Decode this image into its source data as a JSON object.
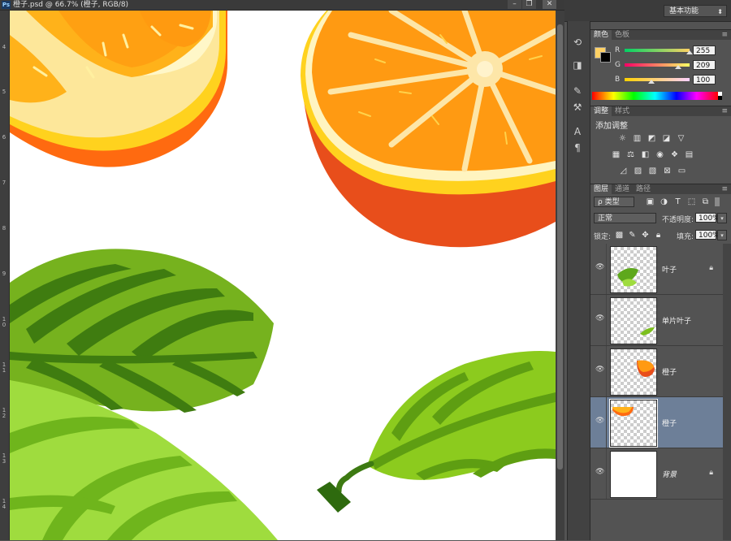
{
  "document": {
    "title": "橙子.psd @ 66.7% (橙子, RGB/8)",
    "app_badge": "Ps",
    "window_controls": [
      "–",
      "❐",
      "✕"
    ],
    "ruler_labels": [
      "4",
      "5",
      "6",
      "7",
      "8",
      "9",
      "1\n0",
      "1\n1",
      "1\n2",
      "1\n3",
      "1\n4"
    ]
  },
  "workspace": {
    "label": "基本功能"
  },
  "color_panel": {
    "tabs": [
      "颜色",
      "色板"
    ],
    "fg_color": "#ffd164",
    "bg_color": "#000000",
    "r_label": "R",
    "g_label": "G",
    "b_label": "B",
    "r_value": "255",
    "g_value": "209",
    "b_value": "100"
  },
  "adjustments_panel": {
    "tabs": [
      "调整",
      "样式"
    ],
    "heading": "添加调整"
  },
  "layers_panel": {
    "tabs": [
      "图层",
      "通道",
      "路径"
    ],
    "filter_label": "ρ 类型",
    "blend_mode": "正常",
    "opacity_label": "不透明度:",
    "opacity_value": "100%",
    "lock_label": "锁定:",
    "fill_label": "填充:",
    "fill_value": "100%",
    "layers": [
      {
        "name": "叶子",
        "locked": true,
        "selected": false
      },
      {
        "name": "单片叶子",
        "locked": false,
        "selected": false
      },
      {
        "name": "橙子",
        "locked": false,
        "selected": false
      },
      {
        "name": "橙子",
        "locked": false,
        "selected": true
      },
      {
        "name": "背景",
        "locked": true,
        "selected": false
      }
    ]
  },
  "icons": {
    "eye": "eye-icon",
    "lock": "lock-icon",
    "panel_menu": "panel-menu-icon"
  }
}
